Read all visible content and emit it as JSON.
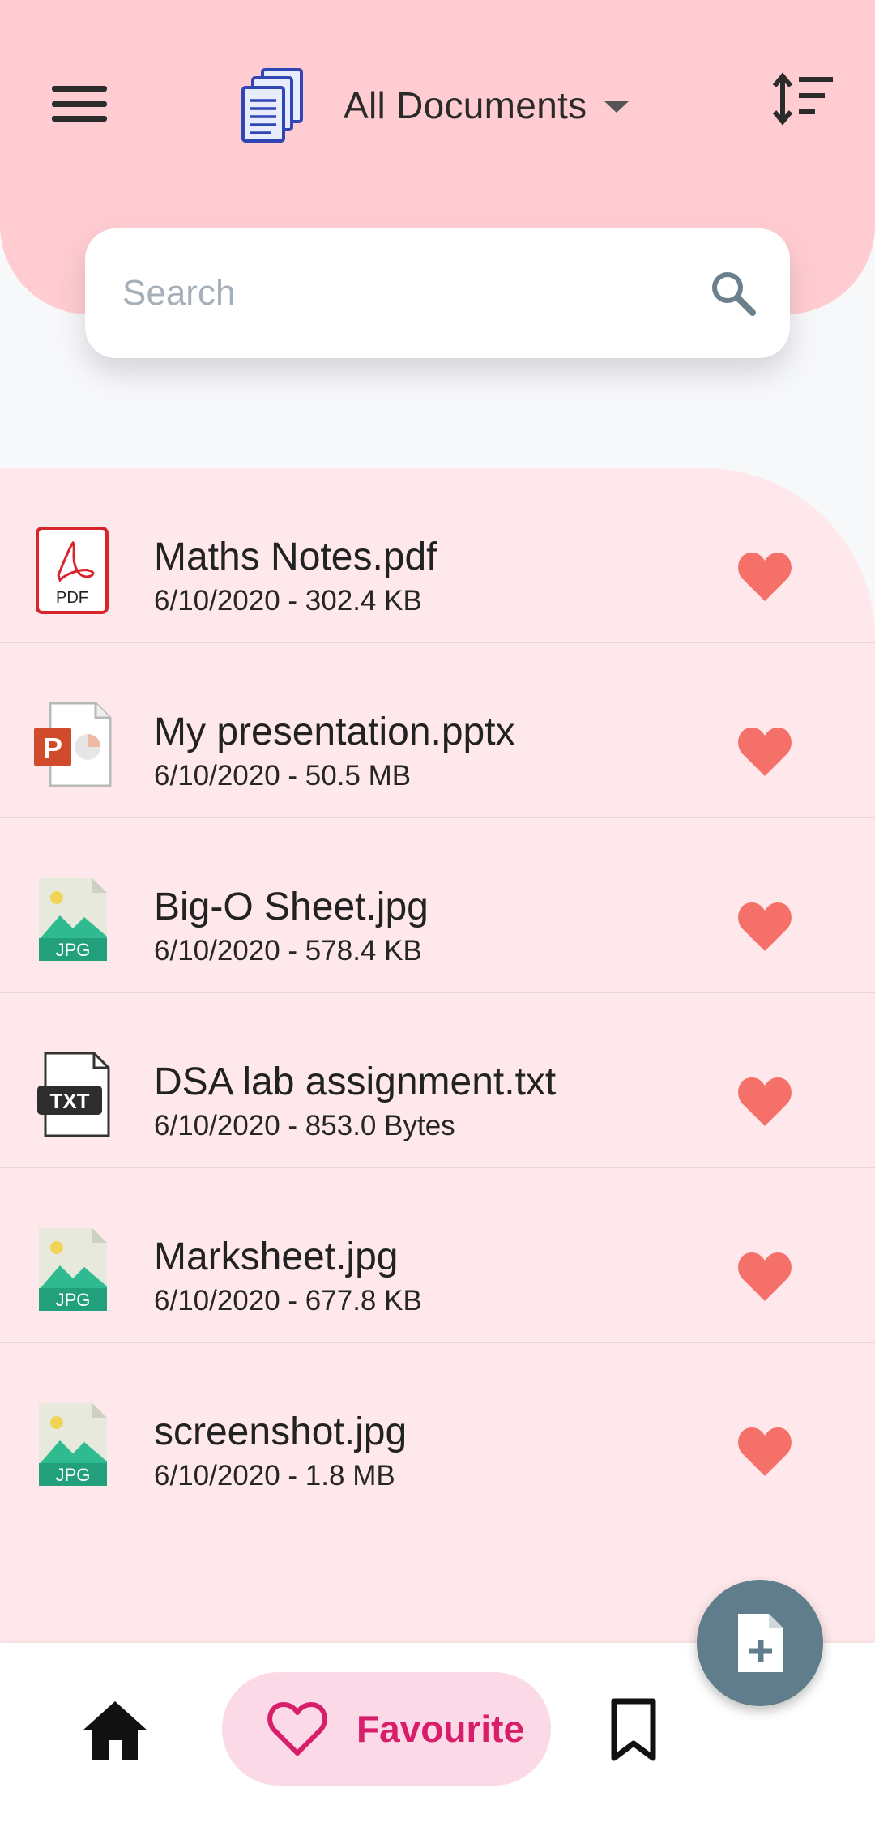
{
  "header": {
    "title": "All Documents",
    "icons": {
      "menu": "menu-icon",
      "documents": "documents-icon",
      "dropdown": "caret-down-icon",
      "sort": "sort-icon"
    },
    "background_color": "#ffccd1"
  },
  "search": {
    "placeholder": "Search",
    "value": "",
    "icon": "search-icon"
  },
  "files": [
    {
      "name": "Maths Notes.pdf",
      "meta": "6/10/2020 - 302.4 KB",
      "type": "pdf",
      "favourite": true
    },
    {
      "name": "My presentation.pptx",
      "meta": "6/10/2020 - 50.5 MB",
      "type": "pptx",
      "favourite": true
    },
    {
      "name": "Big-O Sheet.jpg",
      "meta": "6/10/2020 - 578.4 KB",
      "type": "jpg",
      "favourite": true
    },
    {
      "name": "DSA lab assignment.txt",
      "meta": "6/10/2020 - 853.0 Bytes",
      "type": "txt",
      "favourite": true
    },
    {
      "name": "Marksheet.jpg",
      "meta": "6/10/2020 - 677.8 KB",
      "type": "jpg",
      "favourite": true
    },
    {
      "name": "screenshot.jpg",
      "meta": "6/10/2020 - 1.8 MB",
      "type": "jpg",
      "favourite": true
    }
  ],
  "icon_labels": {
    "pdf": "PDF",
    "pptx": "P",
    "jpg": "JPG",
    "txt": "TXT"
  },
  "fab": {
    "icon": "add-document-icon",
    "color": "#5f7d8b"
  },
  "bottom_nav": {
    "items": [
      {
        "icon": "home-icon",
        "label": ""
      },
      {
        "icon": "heart-outline-icon",
        "label": "Favourite",
        "selected": true
      },
      {
        "icon": "bookmark-icon",
        "label": ""
      }
    ]
  },
  "colors": {
    "accent": "#d81e6b",
    "heart": "#f47068",
    "list_background": "#ffe8eb"
  }
}
